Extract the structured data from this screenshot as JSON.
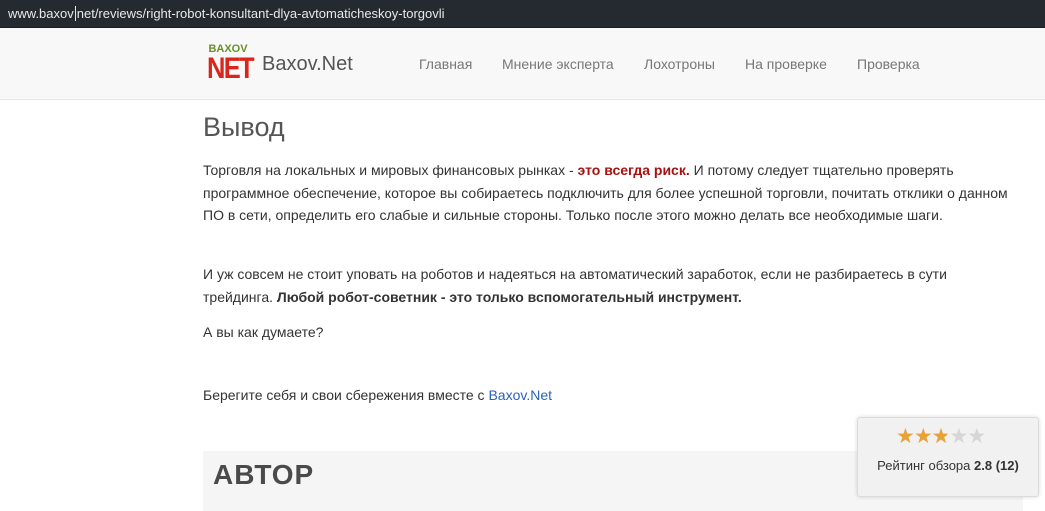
{
  "browser": {
    "url_before_caret": "www.baxov",
    "url_after_caret": "net/reviews/right-robot-konsultant-dlya-avtomaticheskoy-torgovli"
  },
  "header": {
    "logo_top": "BAXOV",
    "logo_bottom": "NET",
    "brand": "Baxov.Net",
    "nav": [
      {
        "label": "Главная"
      },
      {
        "label": "Мнение эксперта"
      },
      {
        "label": "Лохотроны"
      },
      {
        "label": "На проверке"
      },
      {
        "label": "Проверка"
      }
    ]
  },
  "article": {
    "title": "Вывод",
    "p1_a": "Торговля на локальных и мировых финансовых рынках - ",
    "p1_risk": "это всегда риск.",
    "p1_b": " И потому следует тщательно проверять программное обеспечение, которое вы собираетесь подключить для более успешной торговли, почитать отклики о данном ПО в сети, определить его слабые и сильные стороны. Только после этого можно делать все необходимые шаги.",
    "p2_a": "И уж совсем не стоит уповать на роботов и надеяться на автоматический заработок, если не разбираетесь в сути трейдинга. ",
    "p2_bold": "Любой робот-советник - это только вспомогательный инструмент.",
    "p3": "А вы как думаете?",
    "p4_a": "Берегите себя и свои сбережения вместе с ",
    "p4_link": "Baxov.Net"
  },
  "author": {
    "title": "АВТОР"
  },
  "rating": {
    "label": "Рейтинг обзора",
    "value": "2.8",
    "count": "(12)",
    "stars_total": 5,
    "stars_value": 2.8,
    "star_color": "#e8a23a",
    "star_empty_color": "#d6d6d6"
  },
  "colors": {
    "risk": "#a81010",
    "link": "#2a63b8",
    "logo_red": "#d9261c",
    "logo_green": "#6a8f2a"
  }
}
